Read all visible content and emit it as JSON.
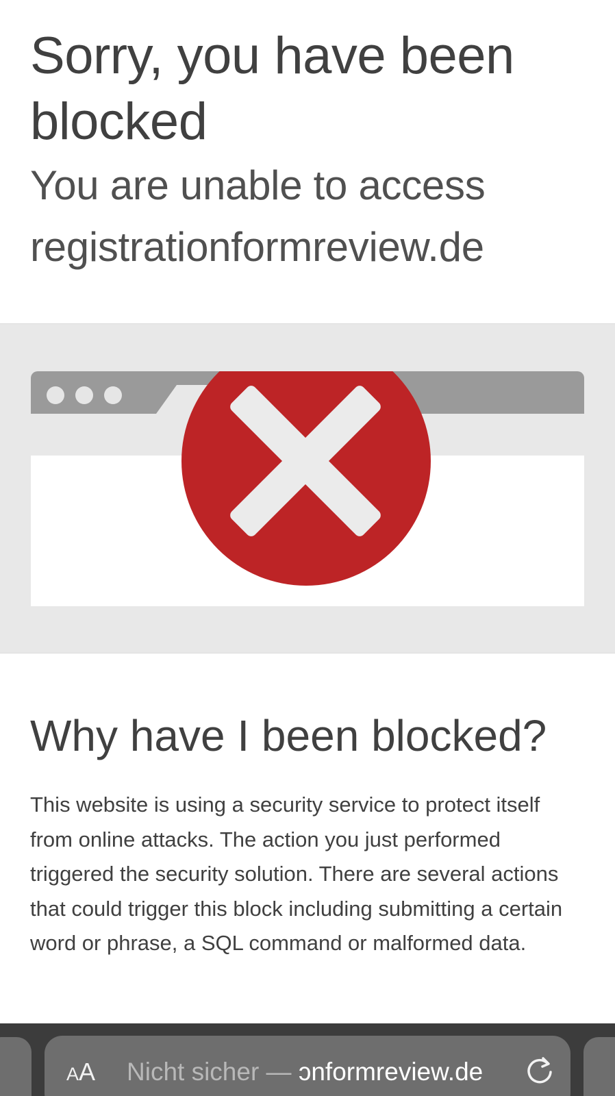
{
  "page": {
    "title": "Sorry, you have been blocked",
    "subtitle": "You are unable to access registrationformreview.de"
  },
  "why": {
    "heading": "Why have I been blocked?",
    "body": "This website is using a security service to protect itself from online attacks. The action you just performed triggered the security solution. There are several actions that could trigger this block including submitting a certain word or phrase, a SQL command or malformed data."
  },
  "toolbar": {
    "text_size_small": "A",
    "text_size_large": "A",
    "url_prefix": "Nicht sicher — ",
    "url_host": "ɔnformreview.de",
    "reload_icon": "reload-icon"
  },
  "illustration": {
    "icon": "error-x-icon",
    "icon_color": "#bd2426"
  },
  "colors": {
    "text": "#404040",
    "band": "#e8e8e8",
    "toolbar": "#3c3c3c",
    "address_bar": "#6e6e6e"
  }
}
